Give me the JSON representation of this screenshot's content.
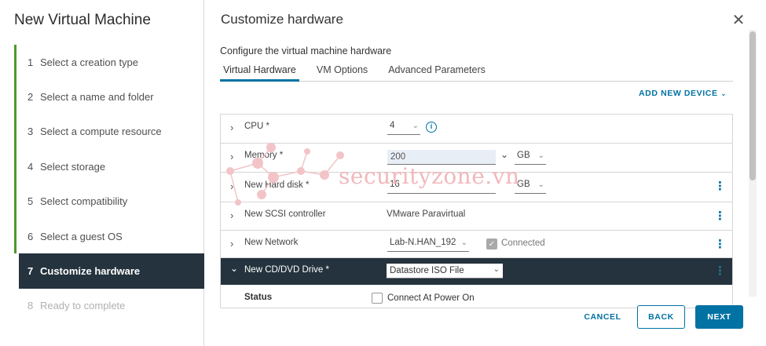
{
  "wizard": {
    "title": "New Virtual Machine",
    "steps": [
      {
        "num": "1",
        "label": "Select a creation type"
      },
      {
        "num": "2",
        "label": "Select a name and folder"
      },
      {
        "num": "3",
        "label": "Select a compute resource"
      },
      {
        "num": "4",
        "label": "Select storage"
      },
      {
        "num": "5",
        "label": "Select compatibility"
      },
      {
        "num": "6",
        "label": "Select a guest OS"
      },
      {
        "num": "7",
        "label": "Customize hardware"
      },
      {
        "num": "8",
        "label": "Ready to complete"
      }
    ]
  },
  "page": {
    "title": "Customize hardware",
    "subtitle": "Configure the virtual machine hardware",
    "tabs": [
      "Virtual Hardware",
      "VM Options",
      "Advanced Parameters"
    ],
    "add_device": "ADD NEW DEVICE"
  },
  "hardware": {
    "cpu": {
      "label": "CPU *",
      "value": "4"
    },
    "memory": {
      "label": "Memory *",
      "value": "200",
      "unit": "GB"
    },
    "hard_disk": {
      "label": "New Hard disk *",
      "value": "16",
      "unit": "GB"
    },
    "scsi": {
      "label": "New SCSI controller",
      "value": "VMware Paravirtual"
    },
    "network": {
      "label": "New Network",
      "value": "Lab-N.HAN_192",
      "connected_label": "Connected"
    },
    "cd_dvd": {
      "label": "New CD/DVD Drive *",
      "value": "Datastore ISO File"
    },
    "status": {
      "label": "Status",
      "connect_label": "Connect At Power On"
    }
  },
  "footer": {
    "cancel": "CANCEL",
    "back": "BACK",
    "next": "NEXT"
  },
  "watermark": {
    "text": "securityzone.vn"
  },
  "colors": {
    "accent": "#0072a3",
    "dark_row": "#24333d",
    "step_bar": "#4d9a2f"
  }
}
